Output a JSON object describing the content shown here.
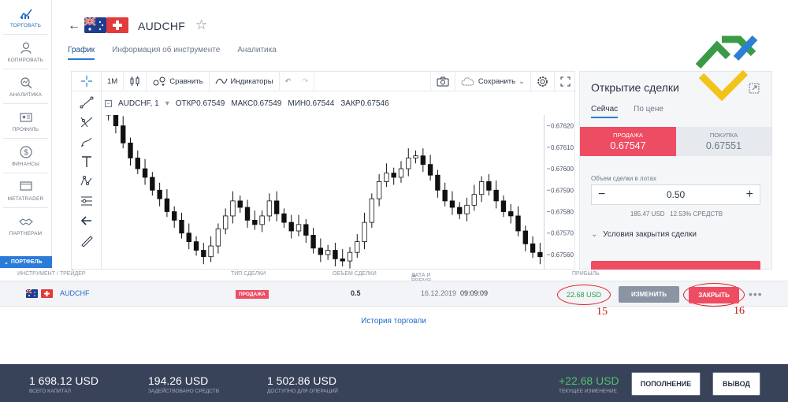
{
  "sidebar": {
    "items": [
      {
        "label": "ТОРГОВАТЬ"
      },
      {
        "label": "КОПИРОВАТЬ"
      },
      {
        "label": "АНАЛИТИКА"
      },
      {
        "label": "ПРОФИЛЬ"
      },
      {
        "label": "ФИНАНСЫ"
      },
      {
        "label": "METATRADER"
      },
      {
        "label": "ПАРТНЕРАМ"
      }
    ],
    "portfolio_label": "ПОРТФЕЛЬ"
  },
  "header": {
    "symbol": "AUDCHF",
    "tabs": [
      "График",
      "Информация об инструменте",
      "Аналитика"
    ]
  },
  "toolbar": {
    "interval": "1M",
    "compare": "Сравнить",
    "indicators": "Индикаторы",
    "save": "Сохранить"
  },
  "chart_legend": {
    "symbol": "AUDCHF, 1",
    "open_label": "ОТКР",
    "open": "0.67549",
    "high_label": "МАКС",
    "high": "0.67549",
    "low_label": "МИН",
    "low": "0.67544",
    "close_label": "ЗАКР",
    "close": "0.67546"
  },
  "chart_data": {
    "type": "candlestick",
    "ylim": [
      0.67553,
      0.67625
    ],
    "yticks": [
      "0.67620",
      "0.67610",
      "0.67600",
      "0.67590",
      "0.67580",
      "0.67570",
      "0.67560"
    ],
    "close": [
      0.67625,
      0.6762,
      0.67612,
      0.67605,
      0.676,
      0.67596,
      0.6759,
      0.67586,
      0.6758,
      0.67576,
      0.6757,
      0.67566,
      0.67562,
      0.67559,
      0.67564,
      0.67572,
      0.67578,
      0.67585,
      0.67582,
      0.67576,
      0.67574,
      0.67578,
      0.67585,
      0.67579,
      0.67575,
      0.67571,
      0.67574,
      0.67569,
      0.67563,
      0.6756,
      0.67562,
      0.67558,
      0.67557,
      0.67561,
      0.67566,
      0.67575,
      0.67586,
      0.67594,
      0.67598,
      0.67596,
      0.676,
      0.67605,
      0.67606,
      0.67602,
      0.67597,
      0.6759,
      0.67585,
      0.67582,
      0.67579,
      0.67583,
      0.67588,
      0.67594,
      0.6759,
      0.67585,
      0.6758,
      0.67578,
      0.67571,
      0.67565,
      0.67561,
      0.67559
    ]
  },
  "panel": {
    "title": "Открытие сделки",
    "tabs": [
      "Сейчас",
      "По цене"
    ],
    "sell_label": "ПРОДАЖА",
    "sell_price": "0.67547",
    "buy_label": "ПОКУПКА",
    "buy_price": "0.67551",
    "volume_label": "Объем сделки в лотах",
    "volume_value": "0.50",
    "volume_info": "185.47 USD   12.53% СРЕДСТВ",
    "close_conditions": "Условия закрытия сделки"
  },
  "positions": {
    "headers": {
      "instrument": "ИНСТРУМЕНТ / ТРЕЙДЕР",
      "type": "ТИП СДЕЛКИ",
      "volume": "ОБЪЕМ СДЕЛКИ",
      "datetime": "ДАТА И ВРЕМЯ ОТКРЫТИЯ",
      "profit": "ПРИБЫЛЬ"
    },
    "row": {
      "instrument": "AUDCHF",
      "type": "ПРОДАЖА",
      "volume": "0.5",
      "date": "16.12.2019",
      "time": "09:09:09",
      "profit": "22.68 USD",
      "change_label": "ИЗМЕНИТЬ",
      "close_label": "ЗАКРЫТЬ"
    },
    "annotations": [
      "15",
      "16"
    ],
    "history_link": "История торговли"
  },
  "footer": {
    "stats": [
      {
        "value": "1 698.12 USD",
        "label": "ВСЕГО КАПИТАЛ"
      },
      {
        "value": "194.26 USD",
        "label": "ЗАДЕЙСТВОВАНО СРЕДСТВ"
      },
      {
        "value": "1 502.86 USD",
        "label": "ДОСТУПНО ДЛЯ ОПЕРАЦИЙ"
      }
    ],
    "change_value": "+22.68 USD",
    "change_label": "ТЕКУЩЕЕ ИЗМЕНЕНИЕ",
    "deposit_label": "ПОПОЛНЕНИЕ",
    "withdraw_label": "ВЫВОД"
  },
  "colors": {
    "accent": "#2b7bd8",
    "sell": "#ee4c63",
    "profit": "#2aa04b",
    "footer_bg": "#38435a"
  }
}
